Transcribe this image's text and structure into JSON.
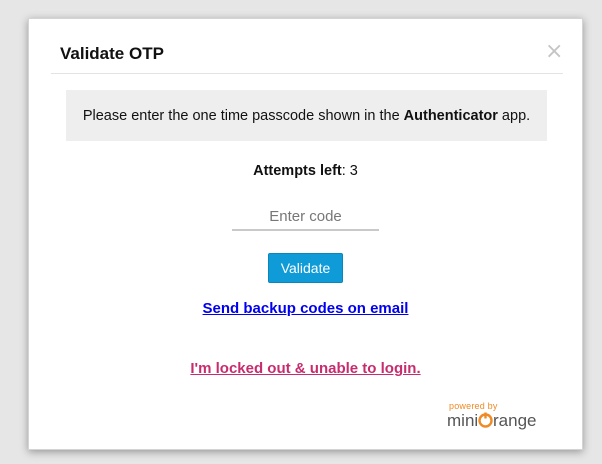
{
  "modal": {
    "title": "Validate OTP",
    "close_label": "×"
  },
  "info": {
    "prefix": "Please enter the one time passcode shown in the ",
    "app_name": "Authenticator",
    "suffix": " app."
  },
  "attempts": {
    "label": "Attempts left",
    "separator": ": ",
    "count": "3"
  },
  "code_input": {
    "placeholder": "Enter code",
    "value": ""
  },
  "validate_button": {
    "label": "Validate"
  },
  "links": {
    "backup": "Send backup codes on email",
    "locked_out": "I'm locked out & unable to login."
  },
  "branding": {
    "powered_by": "powered by",
    "logo_text": "miniOrange"
  },
  "colors": {
    "accent": "#0f9bd7",
    "backup_link": "#0000ee",
    "locked_link": "#c72c6e",
    "brand_orange": "#f08a24"
  }
}
